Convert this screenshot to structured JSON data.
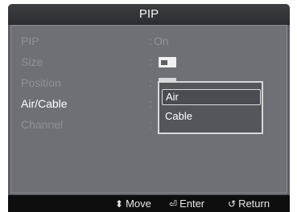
{
  "header": {
    "title": "PIP"
  },
  "menu": {
    "separator": ":",
    "items": [
      {
        "label": "PIP",
        "value": "On"
      },
      {
        "label": "Size",
        "value": "",
        "icon": "size-icon"
      },
      {
        "label": "Position",
        "value": "",
        "icon": "position-icon"
      },
      {
        "label": "Air/Cable",
        "value": ""
      },
      {
        "label": "Channel",
        "value": ""
      }
    ],
    "active_item": "Air/Cable"
  },
  "dropdown": {
    "options": [
      "Air",
      "Cable"
    ],
    "selected": "Air"
  },
  "footer": {
    "move_label": "Move",
    "move_icon": "up-down-arrow-icon",
    "enter_label": "Enter",
    "enter_icon": "enter-icon",
    "return_label": "Return",
    "return_icon": "return-icon"
  },
  "colors": {
    "background": "#5b5e64",
    "panel": "#6e7076",
    "dim_text": "#909297",
    "active_text": "#ffffff",
    "bottom_bar": "#0e0e0e"
  }
}
